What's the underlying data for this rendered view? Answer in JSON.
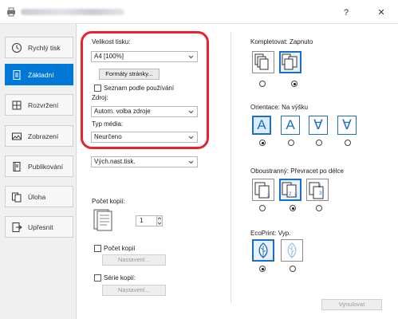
{
  "titlebar": {
    "help_label": "?",
    "close_label": "✕"
  },
  "sidebar": {
    "items": [
      {
        "label": "Rychlý tisk",
        "icon": "clock-icon"
      },
      {
        "label": "Základní",
        "icon": "document-icon"
      },
      {
        "label": "Rozvržení",
        "icon": "layout-grid-icon"
      },
      {
        "label": "Zobrazení",
        "icon": "image-icon"
      },
      {
        "label": "Publikování",
        "icon": "book-icon"
      },
      {
        "label": "Úloha",
        "icon": "job-pages-icon"
      },
      {
        "label": "Upřesnit",
        "icon": "advanced-arrow-icon"
      }
    ],
    "active_index": 1,
    "accent": "#0078d7"
  },
  "left": {
    "print_size_label": "Velikost tisku:",
    "print_size_value": "A4 [100%]",
    "page_formats_button": "Formáty stránky...",
    "list_by_name_label": "Seznam podle používání",
    "source_label": "Zdroj:",
    "source_value": "Autom. volba zdroje",
    "media_type_label": "Typ média:",
    "media_type_value": "Neurčeno",
    "output_value": "Vých.nast.tisk.",
    "copies_label": "Počet kopií:",
    "copies_value": "1",
    "copy_count_label": "Počet kopií",
    "copy_count_settings": "Nastavení...",
    "copy_series_label": "Série kopií:",
    "copy_series_settings": "Nastavení..."
  },
  "right": {
    "collate_label": "Kompletovat:",
    "collate_value": "Zapnuto",
    "orientation_label": "Orientace:",
    "orientation_value": "Na výšku",
    "orientation_glyphs": [
      "A",
      "A",
      "∀",
      "∀"
    ],
    "duplex_label": "Oboustranný:",
    "duplex_value": "Převracet po délce",
    "duplex_page_numbers": [
      "3",
      "2",
      "3",
      "2",
      "3"
    ],
    "ecoprint_label": "EcoPrint:",
    "ecoprint_value": "Vyp.",
    "reset_button": "Vynulovat"
  },
  "colors": {
    "highlight": "#e8222f",
    "selection": "#1a6fc4"
  }
}
